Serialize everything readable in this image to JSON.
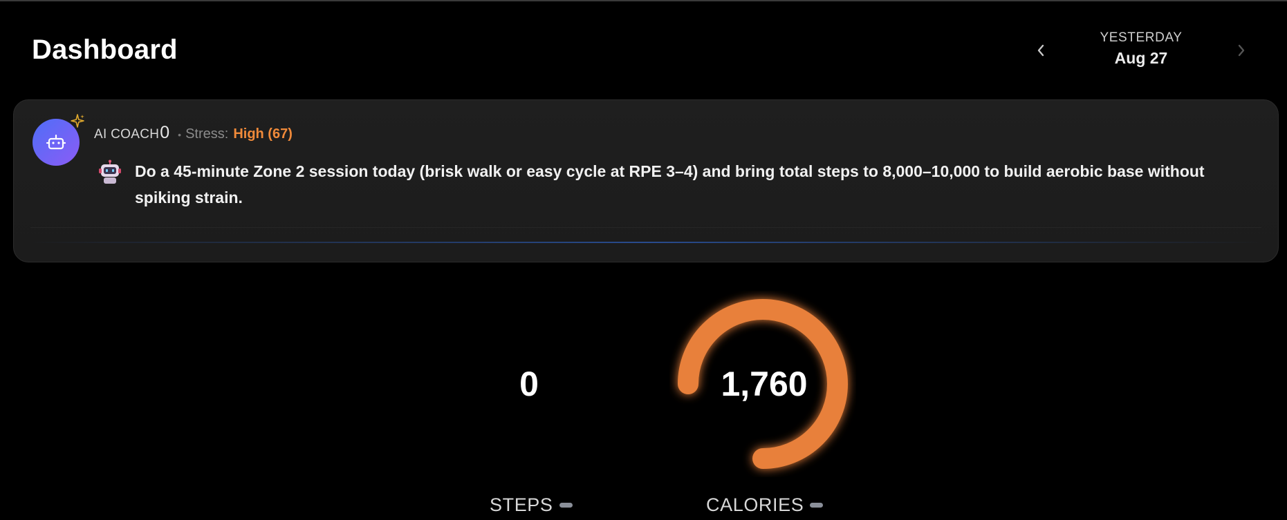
{
  "header": {
    "title": "Dashboard"
  },
  "date_nav": {
    "label": "YESTERDAY",
    "date": "Aug 27",
    "prev_icon": "chevron-left-icon",
    "next_icon": "chevron-right-icon"
  },
  "coach": {
    "label": "AI COACH",
    "count": "0",
    "separator": "•",
    "stress_label": "Stress:",
    "stress_value": "High (67)",
    "message": "Do a 45-minute Zone 2 session today (brisk walk or easy cycle at RPE 3–4) and bring total steps to 8,000–10,000 to build aerobic base without spiking strain.",
    "avatar_icon": "robot-icon",
    "badge_icon": "sparkle-icon",
    "message_icon": "robot-emoji-icon"
  },
  "metrics": {
    "steps": {
      "value": "0",
      "label": "STEPS"
    },
    "calories": {
      "value": "1,760",
      "label": "CALORIES",
      "ring_progress": 0.75
    }
  },
  "colors": {
    "accent_orange": "#f08a3a",
    "ring_orange": "#e8803a",
    "avatar_gradient_start": "#4f6ef7",
    "avatar_gradient_end": "#8b5cf6",
    "background": "#000000"
  }
}
